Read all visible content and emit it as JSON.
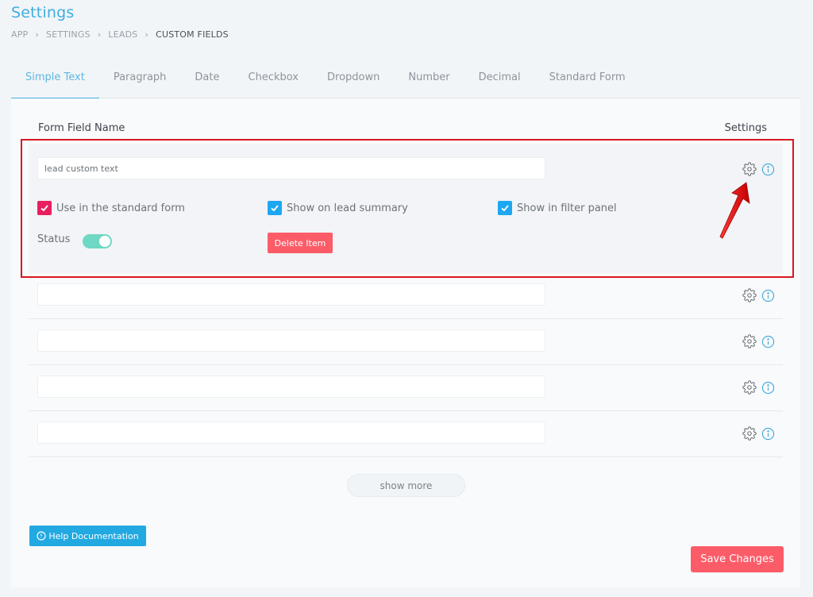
{
  "header": {
    "title": "Settings",
    "breadcrumb": [
      "APP",
      "SETTINGS",
      "LEADS",
      "CUSTOM FIELDS"
    ]
  },
  "tabs": [
    {
      "label": "Simple Text",
      "active": true
    },
    {
      "label": "Paragraph",
      "active": false
    },
    {
      "label": "Date",
      "active": false
    },
    {
      "label": "Checkbox",
      "active": false
    },
    {
      "label": "Dropdown",
      "active": false
    },
    {
      "label": "Number",
      "active": false
    },
    {
      "label": "Decimal",
      "active": false
    },
    {
      "label": "Standard Form",
      "active": false
    }
  ],
  "table": {
    "col_name": "Form Field Name",
    "col_settings": "Settings",
    "rows": [
      {
        "value": "lead custom text",
        "expanded": true,
        "options": [
          {
            "label": "Use in the standard form",
            "checked": true,
            "color": "#e91e5e"
          },
          {
            "label": "Show on lead summary",
            "checked": true,
            "color": "#1ea7f1"
          },
          {
            "label": "Show in filter panel",
            "checked": true,
            "color": "#1ea7f1"
          }
        ],
        "status_label": "Status",
        "status_on": true,
        "delete_label": "Delete Item"
      },
      {
        "value": "",
        "expanded": false
      },
      {
        "value": "",
        "expanded": false
      },
      {
        "value": "",
        "expanded": false
      },
      {
        "value": "",
        "expanded": false
      }
    ],
    "icons": {
      "settings": "gear-icon",
      "info": "info-icon"
    }
  },
  "actions": {
    "show_more": "show more",
    "help": "Help Documentation",
    "save": "Save Changes"
  },
  "colors": {
    "accent": "#3fb1e3",
    "danger": "#fc5c68",
    "toggle_on": "#6fd8c4",
    "annotation": "#d9171e"
  }
}
